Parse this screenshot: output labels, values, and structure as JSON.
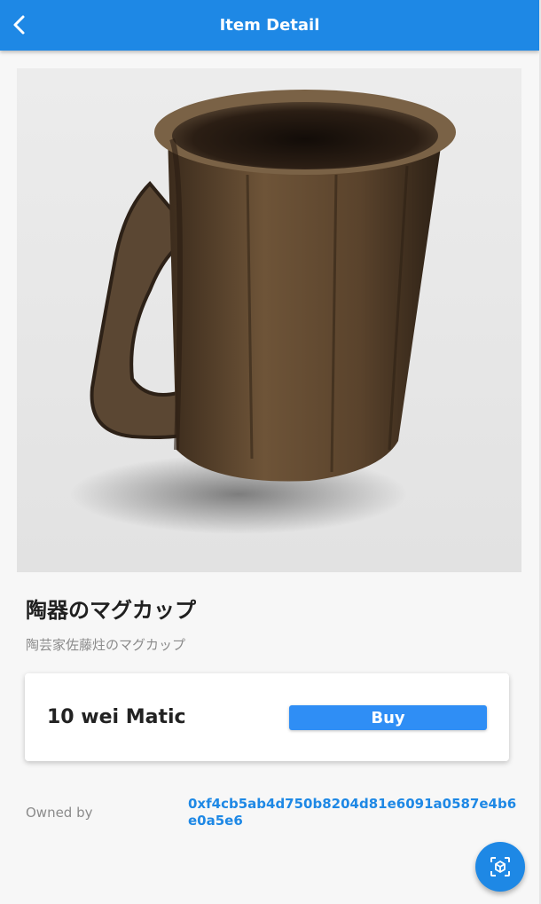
{
  "header": {
    "title": "Item Detail",
    "back_icon": "arrow-back-icon"
  },
  "item": {
    "name": "陶器のマグカップ",
    "description": "陶芸家佐藤炷のマグカップ",
    "image_alt": "ceramic mug"
  },
  "purchase": {
    "price": "10 wei Matic",
    "buy_label": "Buy"
  },
  "ownership": {
    "label": "Owned by",
    "address": "0xf4cb5ab4d750b8204d81e6091a0587e4b6e0a5e6"
  },
  "fab": {
    "icon": "3d-view-icon"
  },
  "colors": {
    "primary": "#1e88e5",
    "button": "#2f8ef5"
  }
}
